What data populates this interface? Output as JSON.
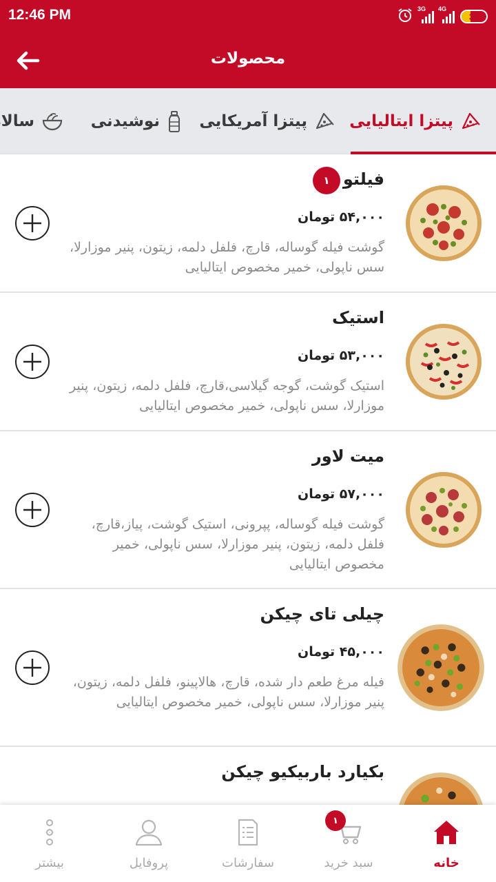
{
  "status_bar": {
    "time": "12:46 PM",
    "network_1": "3G",
    "network_2": "4G",
    "battery": "36",
    "battery_percent": 36
  },
  "app_bar": {
    "title": "محصولات",
    "back_icon": "arrow-left-icon"
  },
  "tabs": [
    {
      "label": "پیتزا ایتالیایی",
      "icon": "pizza-slice-icon",
      "active": true
    },
    {
      "label": "پیتزا آمریکایی",
      "icon": "pizza-slice-icon",
      "active": false
    },
    {
      "label": "نوشیدنی",
      "icon": "bottle-icon",
      "active": false
    },
    {
      "label": "سالاد",
      "icon": "salad-bowl-icon",
      "active": false
    }
  ],
  "products": [
    {
      "name": "فیلتو",
      "price": "۵۴,۰۰۰ تومان",
      "description": "گوشت فیله گوساله، قارچ، فلفل دلمه، زیتون، پنیر موزارلا، سس ناپولی، خمیر مخصوص ایتالیایی",
      "cart_quantity": "۱"
    },
    {
      "name": "استیک",
      "price": "۵۳,۰۰۰ تومان",
      "description": "استیک گوشت، گوجه گیلاسی،قارچ، فلفل دلمه، زیتون، پنیر موزارلا، سس ناپولی، خمیر مخصوص ایتالیایی"
    },
    {
      "name": "میت لاور",
      "price": "۵۷,۰۰۰ تومان",
      "description": "گوشت فیله گوساله، پپرونی، استیک گوشت، پیاز،قارچ، فلفل دلمه، زیتون، پنیر موزارلا، سس ناپولی، خمیر مخصوص ایتالیایی"
    },
    {
      "name": "چیلی تای چیکن",
      "price": "۴۵,۰۰۰ تومان",
      "description": "فیله مرغ طعم دار شده، قارچ، هالاپینو، فلفل دلمه، زیتون، پنیر موزارلا، سس ناپولی، خمیر مخصوص ایتالیایی"
    },
    {
      "name": "بکیارد باربیکیو چیکن",
      "price": "",
      "description": ""
    }
  ],
  "bottom_nav": [
    {
      "label": "خانه",
      "icon": "home-icon",
      "active": true
    },
    {
      "label": "سبد خرید",
      "icon": "cart-icon",
      "active": false,
      "badge": "۱"
    },
    {
      "label": "سفارشات",
      "icon": "orders-list-icon",
      "active": false
    },
    {
      "label": "پروفایل",
      "icon": "profile-icon",
      "active": false
    },
    {
      "label": "بیشتر",
      "icon": "more-dots-icon",
      "active": false
    }
  ],
  "colors": {
    "primary": "#c30a26",
    "tab_background": "#e8e9ec",
    "description_text": "#8a8a8a",
    "inactive_nav": "#a9a9a9"
  }
}
